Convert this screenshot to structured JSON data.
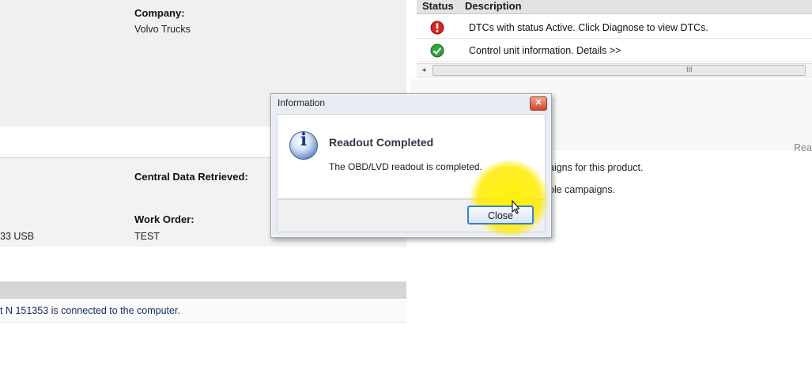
{
  "vehicle_info": {
    "company_label": "Company:",
    "company_value": "Volvo Trucks",
    "central_data_label": "Central Data Retrieved:",
    "work_order_label": "Work Order:",
    "work_order_value": "TEST",
    "adapter_partial": "33 USB"
  },
  "connection": {
    "message": "t N 151353 is connected to the computer."
  },
  "status_table": {
    "col_status": "Status",
    "col_description": "Description",
    "rows": [
      {
        "status": "error",
        "description": "DTCs with status Active. Click Diagnose to view DTCs."
      },
      {
        "status": "ok",
        "description": "Control unit information. Details >>"
      }
    ],
    "scroll_grip": "III"
  },
  "right_panel": {
    "partial_label": "Rea",
    "campaign_line1": "aigns for this product.",
    "campaign_line2": "ole campaigns."
  },
  "dialog": {
    "title": "Information",
    "close_x": "✕",
    "heading": "Readout Completed",
    "message": "The OBD/LVD readout is completed.",
    "close_button": "Close"
  },
  "colors": {
    "error": "#d9241c",
    "ok": "#2fa33a",
    "accent": "#3c7fd1",
    "highlight": "#ffeb00"
  }
}
